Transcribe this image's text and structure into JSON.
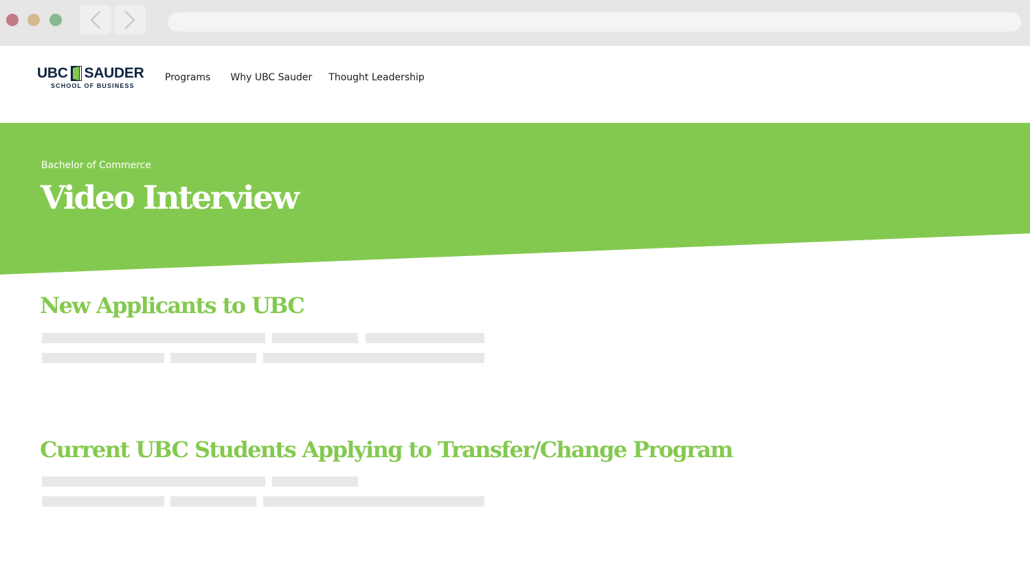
{
  "browser": {
    "back_icon": "chevron-left-icon",
    "forward_icon": "chevron-right-icon",
    "window_controls": [
      "close",
      "minimize",
      "zoom"
    ]
  },
  "header": {
    "logo": {
      "left_word": "UBC",
      "right_word": "SAUDER",
      "subtitle": "SCHOOL OF BUSINESS"
    },
    "nav": [
      "Programs",
      "Why UBC Sauder",
      "Thought Leadership"
    ]
  },
  "hero": {
    "eyebrow": "Bachelor of Commerce",
    "title": "Video Interview",
    "background_color": "#84c94f"
  },
  "sections": [
    {
      "title": "New Applicants to UBC"
    },
    {
      "title": "Current UBC Students Applying to Transfer/Change Program"
    }
  ],
  "colors": {
    "accent_green": "#84c94f",
    "brand_navy": "#0c2340",
    "placeholder_gray": "#e8e8e8"
  }
}
